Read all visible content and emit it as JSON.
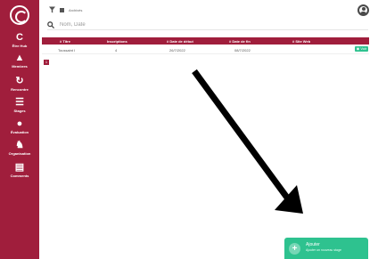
{
  "sidebar": {
    "items": [
      {
        "icon": "C",
        "label": "Être Hub"
      },
      {
        "icon": "▲",
        "label": "Membres"
      },
      {
        "icon": "↻",
        "label": "Rencontre"
      },
      {
        "icon": "☰",
        "label": "Stages"
      },
      {
        "icon": "●",
        "label": "Évaluation"
      },
      {
        "icon": "♞",
        "label": "Organisation"
      },
      {
        "icon": "▤",
        "label": "Comments"
      }
    ]
  },
  "filter": {
    "archive_label": "Archivés"
  },
  "search": {
    "placeholder": "Nom, Date",
    "value": ""
  },
  "table": {
    "columns": [
      "# Titre",
      "Inscriptions",
      "# Date de début",
      "# Date de fin",
      "# Site Web"
    ],
    "rows": [
      {
        "titre": "Toussaint I",
        "inscriptions": "4",
        "debut": "26/7/2022",
        "fin": "08/7/2022",
        "site": "",
        "action": "Voir"
      }
    ]
  },
  "pagination": {
    "current": "1"
  },
  "add_button": {
    "icon": "+",
    "title": "Ajouter",
    "subtitle": "Ajouter un nouveau stage"
  },
  "colors": {
    "brand": "#a01e3c",
    "accent": "#2ec28f"
  }
}
